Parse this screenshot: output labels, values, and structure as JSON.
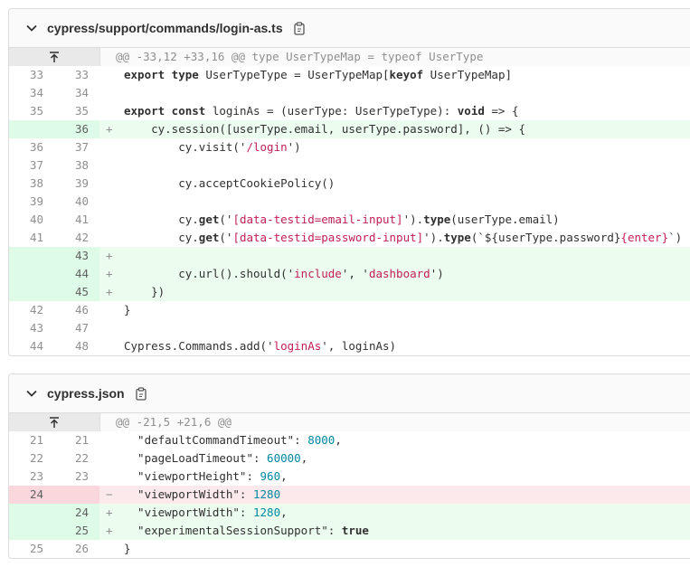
{
  "files": [
    {
      "name": "cypress/support/commands/login-as.ts",
      "hunk_header": "@@ -33,12 +33,16 @@ type UserTypeMap = typeof UserType",
      "lines": [
        {
          "type": "ctx",
          "old": "33",
          "new": "33",
          "tokens": [
            {
              "t": "kw",
              "v": "export type"
            },
            {
              "v": " UserTypeType = UserTypeMap["
            },
            {
              "t": "kw",
              "v": "keyof"
            },
            {
              "v": " UserTypeMap]"
            }
          ]
        },
        {
          "type": "ctx",
          "old": "34",
          "new": "34",
          "tokens": []
        },
        {
          "type": "ctx",
          "old": "35",
          "new": "35",
          "tokens": [
            {
              "t": "kw",
              "v": "export const"
            },
            {
              "v": " loginAs = (userType: UserTypeType): "
            },
            {
              "t": "kw",
              "v": "void"
            },
            {
              "v": " => {"
            }
          ]
        },
        {
          "type": "add",
          "old": "",
          "new": "36",
          "tokens": [
            {
              "v": "    cy.session([userType.email, userType.password], () => {"
            }
          ]
        },
        {
          "type": "ctx",
          "old": "36",
          "new": "37",
          "tokens": [
            {
              "v": "        cy.visit('"
            },
            {
              "t": "str",
              "v": "/login"
            },
            {
              "v": "')"
            }
          ]
        },
        {
          "type": "ctx",
          "old": "37",
          "new": "38",
          "tokens": []
        },
        {
          "type": "ctx",
          "old": "38",
          "new": "39",
          "tokens": [
            {
              "v": "        cy.acceptCookiePolicy()"
            }
          ]
        },
        {
          "type": "ctx",
          "old": "39",
          "new": "40",
          "tokens": []
        },
        {
          "type": "ctx",
          "old": "40",
          "new": "41",
          "tokens": [
            {
              "v": "        cy."
            },
            {
              "t": "kw",
              "v": "get"
            },
            {
              "v": "('"
            },
            {
              "t": "str",
              "v": "[data-testid=email-input]"
            },
            {
              "v": "')."
            },
            {
              "t": "kw",
              "v": "type"
            },
            {
              "v": "(userType.email)"
            }
          ]
        },
        {
          "type": "ctx",
          "old": "41",
          "new": "42",
          "tokens": [
            {
              "v": "        cy."
            },
            {
              "t": "kw",
              "v": "get"
            },
            {
              "v": "('"
            },
            {
              "t": "str",
              "v": "[data-testid=password-input]"
            },
            {
              "v": "')."
            },
            {
              "t": "kw",
              "v": "type"
            },
            {
              "v": "(`${userType.password}"
            },
            {
              "t": "str",
              "v": "{enter}"
            },
            {
              "v": "`)"
            }
          ]
        },
        {
          "type": "add",
          "old": "",
          "new": "43",
          "tokens": []
        },
        {
          "type": "add",
          "old": "",
          "new": "44",
          "tokens": [
            {
              "v": "        cy.url().should('"
            },
            {
              "t": "str",
              "v": "include"
            },
            {
              "v": "', '"
            },
            {
              "t": "str",
              "v": "dashboard"
            },
            {
              "v": "')"
            }
          ]
        },
        {
          "type": "add",
          "old": "",
          "new": "45",
          "tokens": [
            {
              "v": "    })"
            }
          ]
        },
        {
          "type": "ctx",
          "old": "42",
          "new": "46",
          "tokens": [
            {
              "v": "}"
            }
          ]
        },
        {
          "type": "ctx",
          "old": "43",
          "new": "47",
          "tokens": []
        },
        {
          "type": "ctx",
          "old": "44",
          "new": "48",
          "tokens": [
            {
              "v": "Cypress.Commands.add('"
            },
            {
              "t": "str",
              "v": "loginAs"
            },
            {
              "v": "', loginAs)"
            }
          ]
        }
      ]
    },
    {
      "name": "cypress.json",
      "hunk_header": "@@ -21,5 +21,6 @@",
      "lines": [
        {
          "type": "ctx",
          "old": "21",
          "new": "21",
          "tokens": [
            {
              "v": "  \"defaultCommandTimeout\": "
            },
            {
              "t": "num",
              "v": "8000"
            },
            {
              "v": ","
            }
          ]
        },
        {
          "type": "ctx",
          "old": "22",
          "new": "22",
          "tokens": [
            {
              "v": "  \"pageLoadTimeout\": "
            },
            {
              "t": "num",
              "v": "60000"
            },
            {
              "v": ","
            }
          ]
        },
        {
          "type": "ctx",
          "old": "23",
          "new": "23",
          "tokens": [
            {
              "v": "  \"viewportHeight\": "
            },
            {
              "t": "num",
              "v": "960"
            },
            {
              "v": ","
            }
          ]
        },
        {
          "type": "del",
          "old": "24",
          "new": "",
          "tokens": [
            {
              "v": "  \"viewportWidth\": "
            },
            {
              "t": "num",
              "v": "1280"
            }
          ]
        },
        {
          "type": "add",
          "old": "",
          "new": "24",
          "tokens": [
            {
              "v": "  \"viewportWidth\": "
            },
            {
              "t": "num",
              "v": "1280"
            },
            {
              "v": ","
            }
          ]
        },
        {
          "type": "add",
          "old": "",
          "new": "25",
          "tokens": [
            {
              "v": "  \"experimentalSessionSupport\": "
            },
            {
              "t": "kw",
              "v": "true"
            }
          ]
        },
        {
          "type": "ctx",
          "old": "25",
          "new": "26",
          "tokens": [
            {
              "v": "}"
            }
          ]
        }
      ]
    }
  ]
}
